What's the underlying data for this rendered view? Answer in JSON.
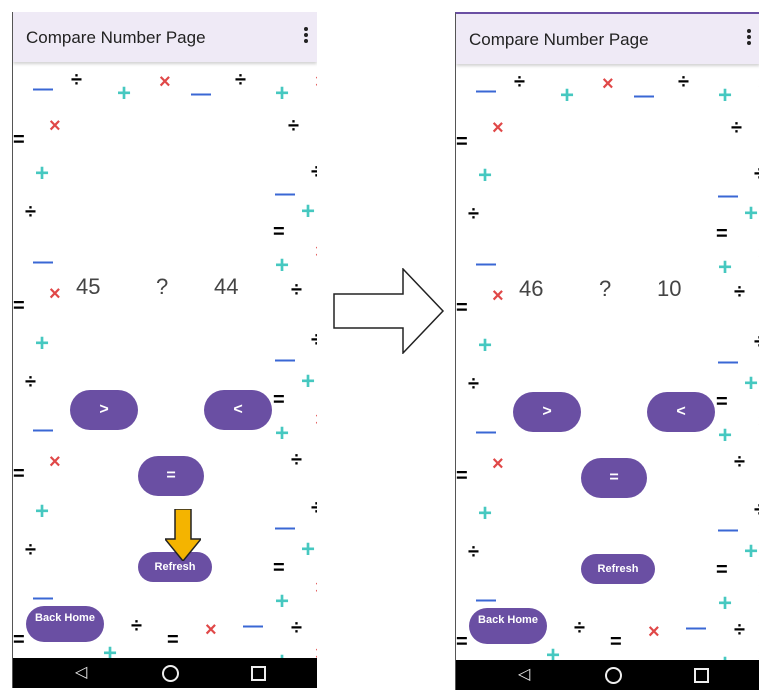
{
  "left_screen": {
    "app_bar": {
      "title": "Compare Number Page",
      "menu_icon": "more-vert-icon"
    },
    "left_number": "45",
    "operator_placeholder": "?",
    "right_number": "44",
    "buttons": {
      "greater": ">",
      "less": "<",
      "equal": "=",
      "refresh": "Refresh",
      "back_home": "Back Home"
    },
    "nav": {
      "back": "◁",
      "home": "○",
      "recent": "□"
    }
  },
  "right_screen": {
    "app_bar": {
      "title": "Compare Number Page",
      "menu_icon": "more-vert-icon"
    },
    "left_number": "46",
    "operator_placeholder": "?",
    "right_number": "10",
    "buttons": {
      "greater": ">",
      "less": "<",
      "equal": "=",
      "refresh": "Refresh",
      "back_home": "Back Home"
    },
    "nav": {
      "back": "◁",
      "home": "○",
      "recent": "□"
    }
  },
  "decorations": {
    "plus": "+",
    "times": "×",
    "divide": "÷",
    "minus": "—",
    "equals": "=",
    "colors": {
      "plus": "#46c8c0",
      "times": "#e04848",
      "divide": "#f28a8a",
      "minus": "#3a67d4",
      "equals": "#f4b400",
      "accent": "#6a4fa3",
      "arrow_yellow": "#f4b400"
    }
  },
  "transition_arrow": "right-arrow-icon",
  "highlight_arrow": "down-arrow-icon"
}
